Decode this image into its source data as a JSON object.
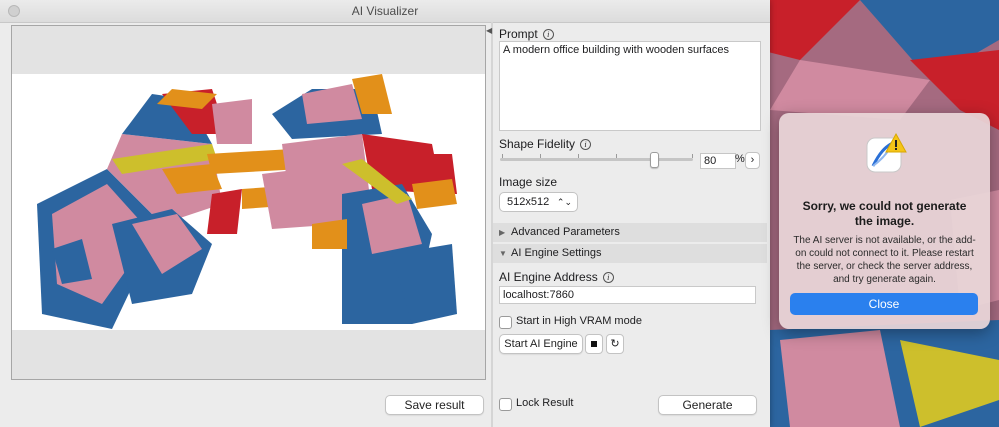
{
  "window": {
    "title": "AI Visualizer"
  },
  "left_pane": {
    "save_result_label": "Save result"
  },
  "prompt": {
    "label": "Prompt",
    "value": "A modern office building with wooden surfaces"
  },
  "shape_fidelity": {
    "label": "Shape Fidelity",
    "value": "80",
    "unit": "%",
    "slider_fraction": 0.8,
    "step_icon": "chevron-right-icon"
  },
  "image_size": {
    "label": "Image size",
    "selected": "512x512"
  },
  "sections": {
    "advanced": "Advanced Parameters",
    "engine": "AI Engine Settings"
  },
  "engine": {
    "address_label": "AI Engine Address",
    "address_value": "localhost:7860",
    "high_vram_label": "Start in High VRAM mode",
    "start_label": "Start AI Engine",
    "stop_icon": "stop-icon",
    "restart_icon": "refresh-icon"
  },
  "footer": {
    "lock_label": "Lock Result",
    "generate_label": "Generate"
  },
  "alert": {
    "title": "Sorry, we could not generate the image.",
    "message": "The AI server is not available, or the add-on could not connect to it. Please restart the server, or check the server address, and try generate again.",
    "close_label": "Close",
    "icon": "warning-app-icon"
  },
  "colors": {
    "accent_blue": "#2a80ee",
    "brick_red": "#c8202a",
    "brick_blue": "#2c65a0",
    "brick_pink": "#d08aa0",
    "brick_orange": "#e2901a",
    "brick_yellow": "#cdbf2c"
  }
}
